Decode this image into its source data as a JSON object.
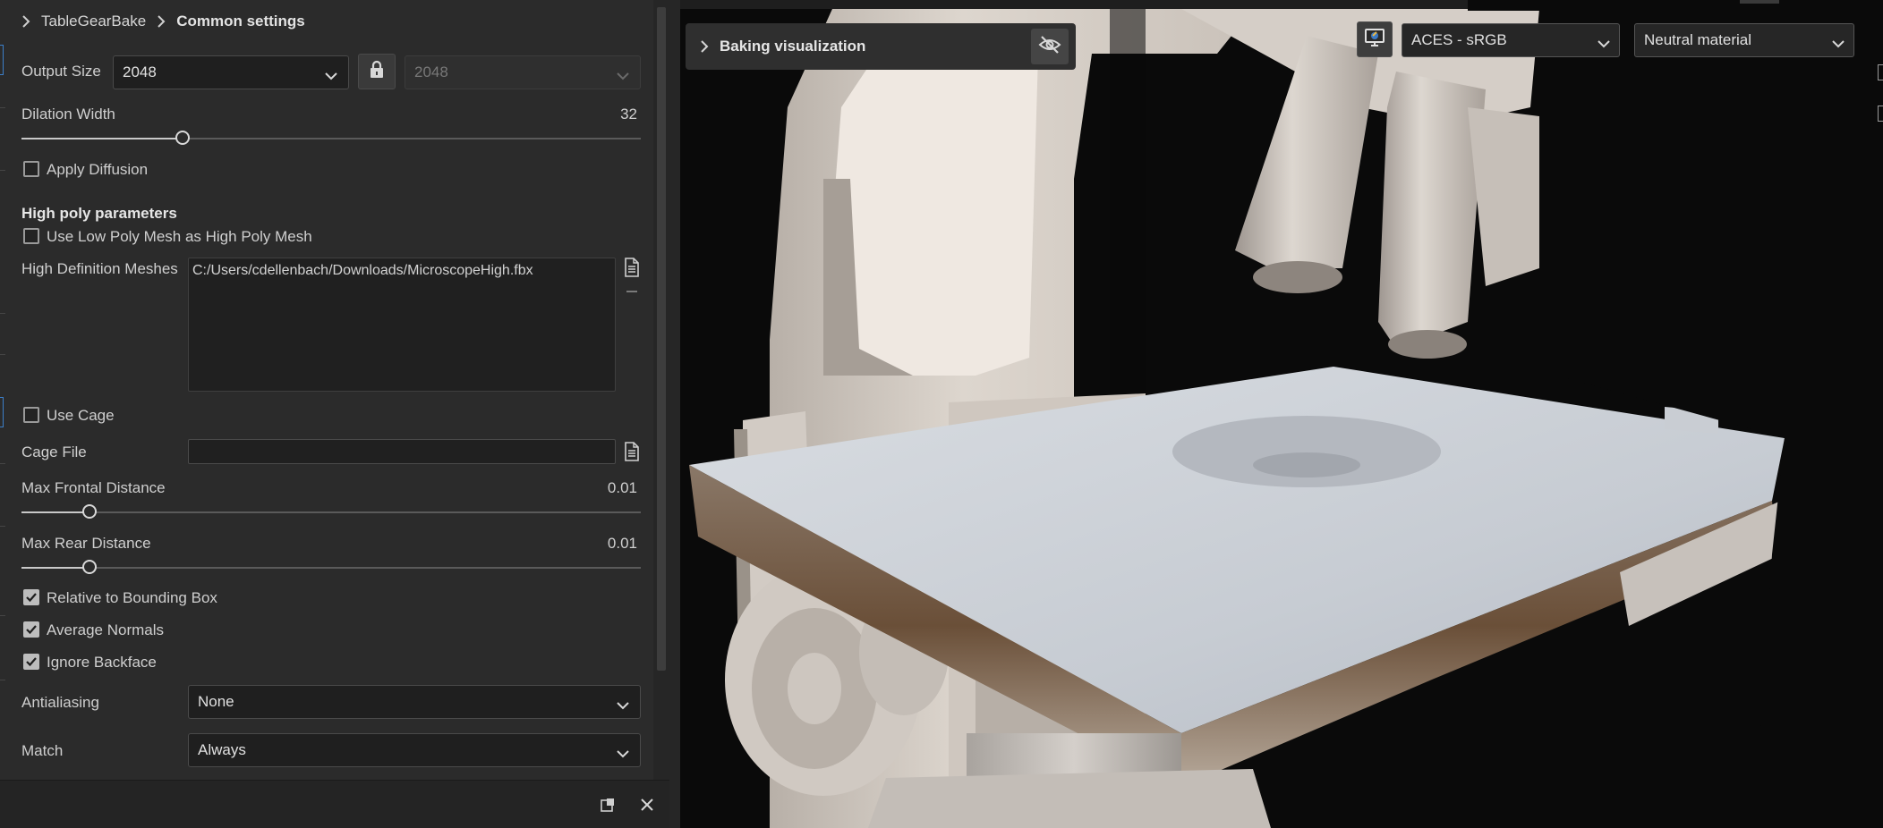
{
  "breadcrumb": {
    "parent": "TableGearBake",
    "current": "Common settings"
  },
  "output_size": {
    "label": "Output Size",
    "value": "2048",
    "linked_value": "2048"
  },
  "dilation_width": {
    "label": "Dilation Width",
    "value": "32",
    "fraction": 0.26
  },
  "apply_diffusion": {
    "label": "Apply Diffusion",
    "checked": false
  },
  "high_poly": {
    "section_title": "High poly parameters",
    "use_low_poly_label": "Use Low Poly Mesh as High Poly Mesh",
    "meshes_label": "High Definition Meshes",
    "meshes_value": "C:/Users/cdellenbach/Downloads/MicroscopeHigh.fbx"
  },
  "cage": {
    "use_cage_label": "Use Cage",
    "cage_file_label": "Cage File",
    "cage_file_value": ""
  },
  "max_frontal": {
    "label": "Max Frontal Distance",
    "value": "0.01",
    "fraction": 0.11
  },
  "max_rear": {
    "label": "Max Rear Distance",
    "value": "0.01",
    "fraction": 0.11
  },
  "relative_bbox": {
    "label": "Relative to Bounding Box",
    "checked": true
  },
  "average_normals": {
    "label": "Average Normals",
    "checked": true
  },
  "ignore_backface": {
    "label": "Ignore Backface",
    "checked": true
  },
  "antialiasing": {
    "label": "Antialiasing",
    "value": "None"
  },
  "match": {
    "label": "Match",
    "value": "Always"
  },
  "viewport": {
    "baking_visualization": "Baking visualization",
    "color_profile": "ACES - sRGB",
    "material": "Neutral material"
  },
  "icons": {
    "chevron": "chevron-right-icon",
    "lock": "lock-icon",
    "file": "file-icon",
    "eye_off": "eye-off-icon",
    "monitor": "monitor-icon",
    "maximize": "maximize-icon",
    "close": "close-icon"
  }
}
